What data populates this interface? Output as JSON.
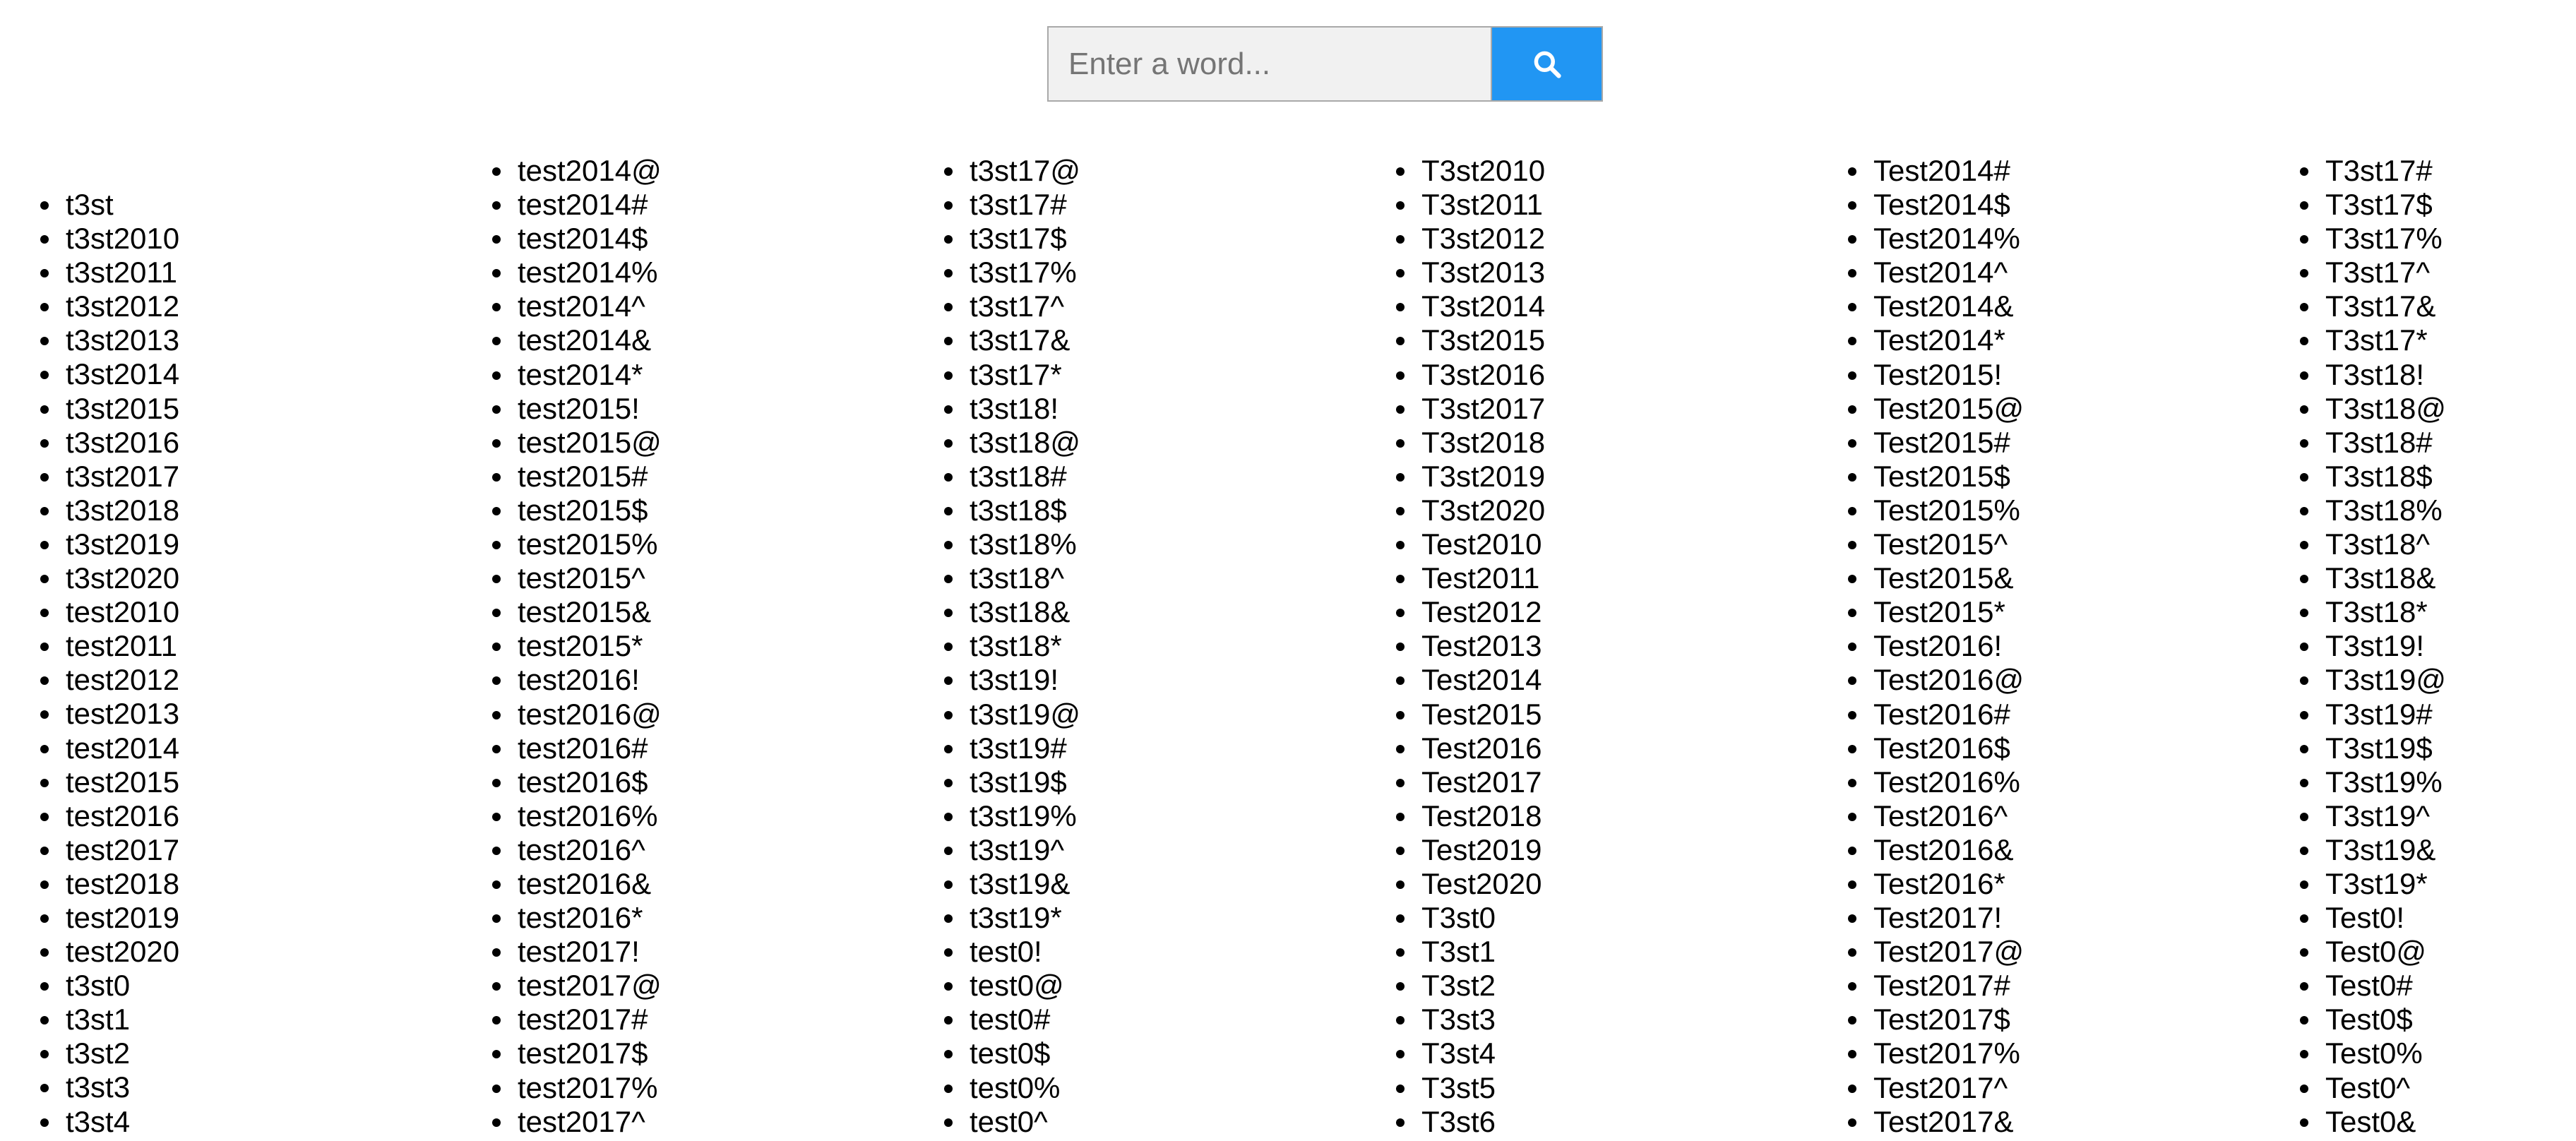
{
  "search": {
    "placeholder": "Enter a word...",
    "button_icon": "search-icon",
    "button_color": "#2196F3"
  },
  "columns": [
    [
      "t3st",
      "t3st2010",
      "t3st2011",
      "t3st2012",
      "t3st2013",
      "t3st2014",
      "t3st2015",
      "t3st2016",
      "t3st2017",
      "t3st2018",
      "t3st2019",
      "t3st2020",
      "test2010",
      "test2011",
      "test2012",
      "test2013",
      "test2014",
      "test2015",
      "test2016",
      "test2017",
      "test2018",
      "test2019",
      "test2020",
      "t3st0",
      "t3st1",
      "t3st2",
      "t3st3",
      "t3st4"
    ],
    [
      "test2014@",
      "test2014#",
      "test2014$",
      "test2014%",
      "test2014^",
      "test2014&",
      "test2014*",
      "test2015!",
      "test2015@",
      "test2015#",
      "test2015$",
      "test2015%",
      "test2015^",
      "test2015&",
      "test2015*",
      "test2016!",
      "test2016@",
      "test2016#",
      "test2016$",
      "test2016%",
      "test2016^",
      "test2016&",
      "test2016*",
      "test2017!",
      "test2017@",
      "test2017#",
      "test2017$",
      "test2017%",
      "test2017^"
    ],
    [
      "t3st17@",
      "t3st17#",
      "t3st17$",
      "t3st17%",
      "t3st17^",
      "t3st17&",
      "t3st17*",
      "t3st18!",
      "t3st18@",
      "t3st18#",
      "t3st18$",
      "t3st18%",
      "t3st18^",
      "t3st18&",
      "t3st18*",
      "t3st19!",
      "t3st19@",
      "t3st19#",
      "t3st19$",
      "t3st19%",
      "t3st19^",
      "t3st19&",
      "t3st19*",
      "test0!",
      "test0@",
      "test0#",
      "test0$",
      "test0%",
      "test0^"
    ],
    [
      "T3st2010",
      "T3st2011",
      "T3st2012",
      "T3st2013",
      "T3st2014",
      "T3st2015",
      "T3st2016",
      "T3st2017",
      "T3st2018",
      "T3st2019",
      "T3st2020",
      "Test2010",
      "Test2011",
      "Test2012",
      "Test2013",
      "Test2014",
      "Test2015",
      "Test2016",
      "Test2017",
      "Test2018",
      "Test2019",
      "Test2020",
      "T3st0",
      "T3st1",
      "T3st2",
      "T3st3",
      "T3st4",
      "T3st5",
      "T3st6"
    ],
    [
      "Test2014#",
      "Test2014$",
      "Test2014%",
      "Test2014^",
      "Test2014&",
      "Test2014*",
      "Test2015!",
      "Test2015@",
      "Test2015#",
      "Test2015$",
      "Test2015%",
      "Test2015^",
      "Test2015&",
      "Test2015*",
      "Test2016!",
      "Test2016@",
      "Test2016#",
      "Test2016$",
      "Test2016%",
      "Test2016^",
      "Test2016&",
      "Test2016*",
      "Test2017!",
      "Test2017@",
      "Test2017#",
      "Test2017$",
      "Test2017%",
      "Test2017^",
      "Test2017&"
    ],
    [
      "T3st17#",
      "T3st17$",
      "T3st17%",
      "T3st17^",
      "T3st17&",
      "T3st17*",
      "T3st18!",
      "T3st18@",
      "T3st18#",
      "T3st18$",
      "T3st18%",
      "T3st18^",
      "T3st18&",
      "T3st18*",
      "T3st19!",
      "T3st19@",
      "T3st19#",
      "T3st19$",
      "T3st19%",
      "T3st19^",
      "T3st19&",
      "T3st19*",
      "Test0!",
      "Test0@",
      "Test0#",
      "Test0$",
      "Test0%",
      "Test0^",
      "Test0&"
    ]
  ]
}
